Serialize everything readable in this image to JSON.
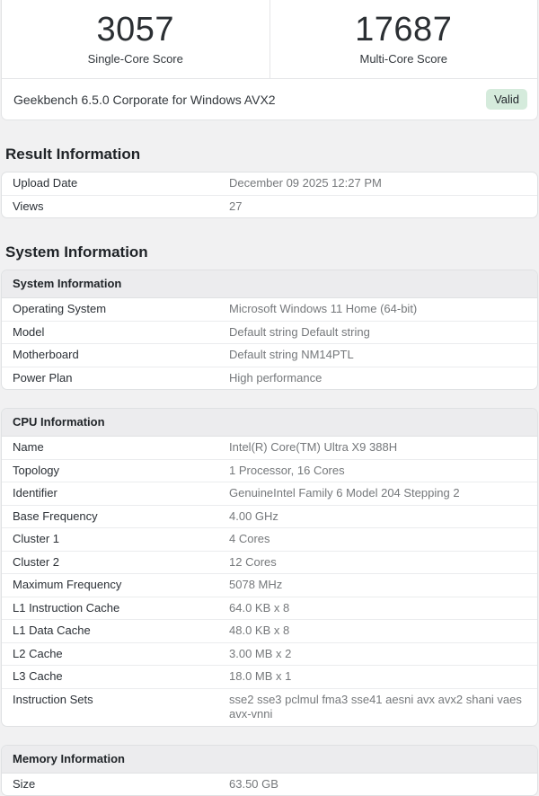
{
  "page_bg": "#f1f1f2",
  "status_colors": {
    "valid_badge_bg": "#d5ebdc",
    "valid_badge_text": "#23282d"
  },
  "score_header": {
    "single_core": {
      "score": "3057",
      "label": "Single-Core Score"
    },
    "multi_core": {
      "score": "17687",
      "label": "Multi-Core Score"
    },
    "benchmark_title": "Geekbench 6.5.0 Corporate for Windows AVX2",
    "status_badge": "Valid"
  },
  "result_section": {
    "heading": "Result Information",
    "table": {
      "rows": [
        [
          "Upload Date",
          "December 09 2025 12:27 PM"
        ],
        [
          "Views",
          "27"
        ]
      ]
    }
  },
  "system_section": {
    "heading": "System Information",
    "system_table": {
      "header": "System Information",
      "rows": [
        [
          "Operating System",
          "Microsoft Windows 11 Home (64-bit)"
        ],
        [
          "Model",
          "Default string Default string"
        ],
        [
          "Motherboard",
          "Default string NM14PTL"
        ],
        [
          "Power Plan",
          "High performance"
        ]
      ]
    },
    "cpu_table": {
      "header": "CPU Information",
      "rows": [
        [
          "Name",
          "Intel(R) Core(TM) Ultra X9 388H"
        ],
        [
          "Topology",
          "1 Processor, 16 Cores"
        ],
        [
          "Identifier",
          "GenuineIntel Family 6 Model 204 Stepping 2"
        ],
        [
          "Base Frequency",
          "4.00 GHz"
        ],
        [
          "Cluster 1",
          "4 Cores"
        ],
        [
          "Cluster 2",
          "12 Cores"
        ],
        [
          "Maximum Frequency",
          "5078 MHz"
        ],
        [
          "L1 Instruction Cache",
          "64.0 KB x 8"
        ],
        [
          "L1 Data Cache",
          "48.0 KB x 8"
        ],
        [
          "L2 Cache",
          "3.00 MB x 2"
        ],
        [
          "L3 Cache",
          "18.0 MB x 1"
        ],
        [
          "Instruction Sets",
          "sse2 sse3 pclmul fma3 sse41 aesni avx avx2 shani vaes avx-vnni"
        ]
      ]
    },
    "memory_table": {
      "header": "Memory Information",
      "rows": [
        [
          "Size",
          "63.50 GB"
        ]
      ]
    }
  }
}
